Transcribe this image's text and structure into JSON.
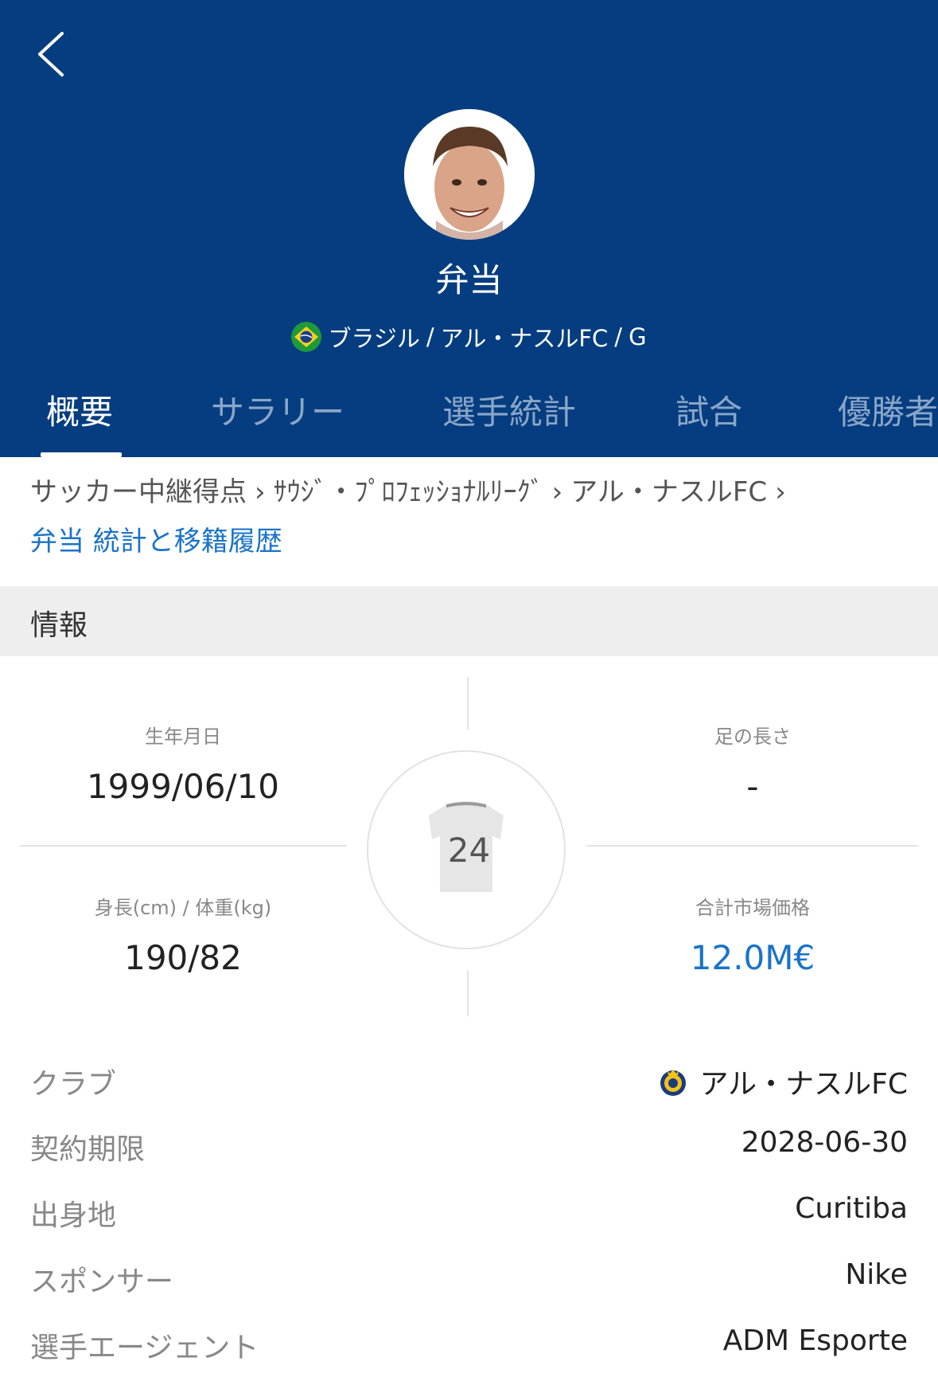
{
  "player": {
    "name": "弁当",
    "nationality": "ブラジル",
    "club": "アル・ナスルFC",
    "position": "G",
    "meta_sep": "/"
  },
  "tabs": [
    {
      "label": "概要",
      "active": true
    },
    {
      "label": "サラリー",
      "active": false
    },
    {
      "label": "選手統計",
      "active": false
    },
    {
      "label": "試合",
      "active": false
    },
    {
      "label": "優勝者",
      "active": false
    }
  ],
  "breadcrumb": {
    "items": [
      "サッカー中継得点",
      "ｻｳｼﾞ・ﾌﾟﾛﾌｪｯｼｮﾅﾙﾘｰｸﾞ",
      "アル・ナスルFC"
    ],
    "current": "弁当 統計と移籍履歴"
  },
  "section": {
    "title": "情報"
  },
  "stats": {
    "birth_label": "生年月日",
    "birth_value": "1999/06/10",
    "foot_label": "足の長さ",
    "foot_value": "-",
    "height_weight_label": "身長(cm) / 体重(kg)",
    "height_weight_value": "190/82",
    "market_label": "合計市場価格",
    "market_value": "12.0M€",
    "jersey_number": "24"
  },
  "info": [
    {
      "label": "クラブ",
      "value": "アル・ナスルFC",
      "icon": "club-crest-icon"
    },
    {
      "label": "契約期限",
      "value": "2028-06-30"
    },
    {
      "label": "出身地",
      "value": "Curitiba"
    },
    {
      "label": "スポンサー",
      "value": "Nike"
    },
    {
      "label": "選手エージェント",
      "value": "ADM Esporte"
    }
  ],
  "colors": {
    "header_bg": "#053d80",
    "link": "#1a73c8",
    "tab_inactive": "#8aa6c8"
  }
}
